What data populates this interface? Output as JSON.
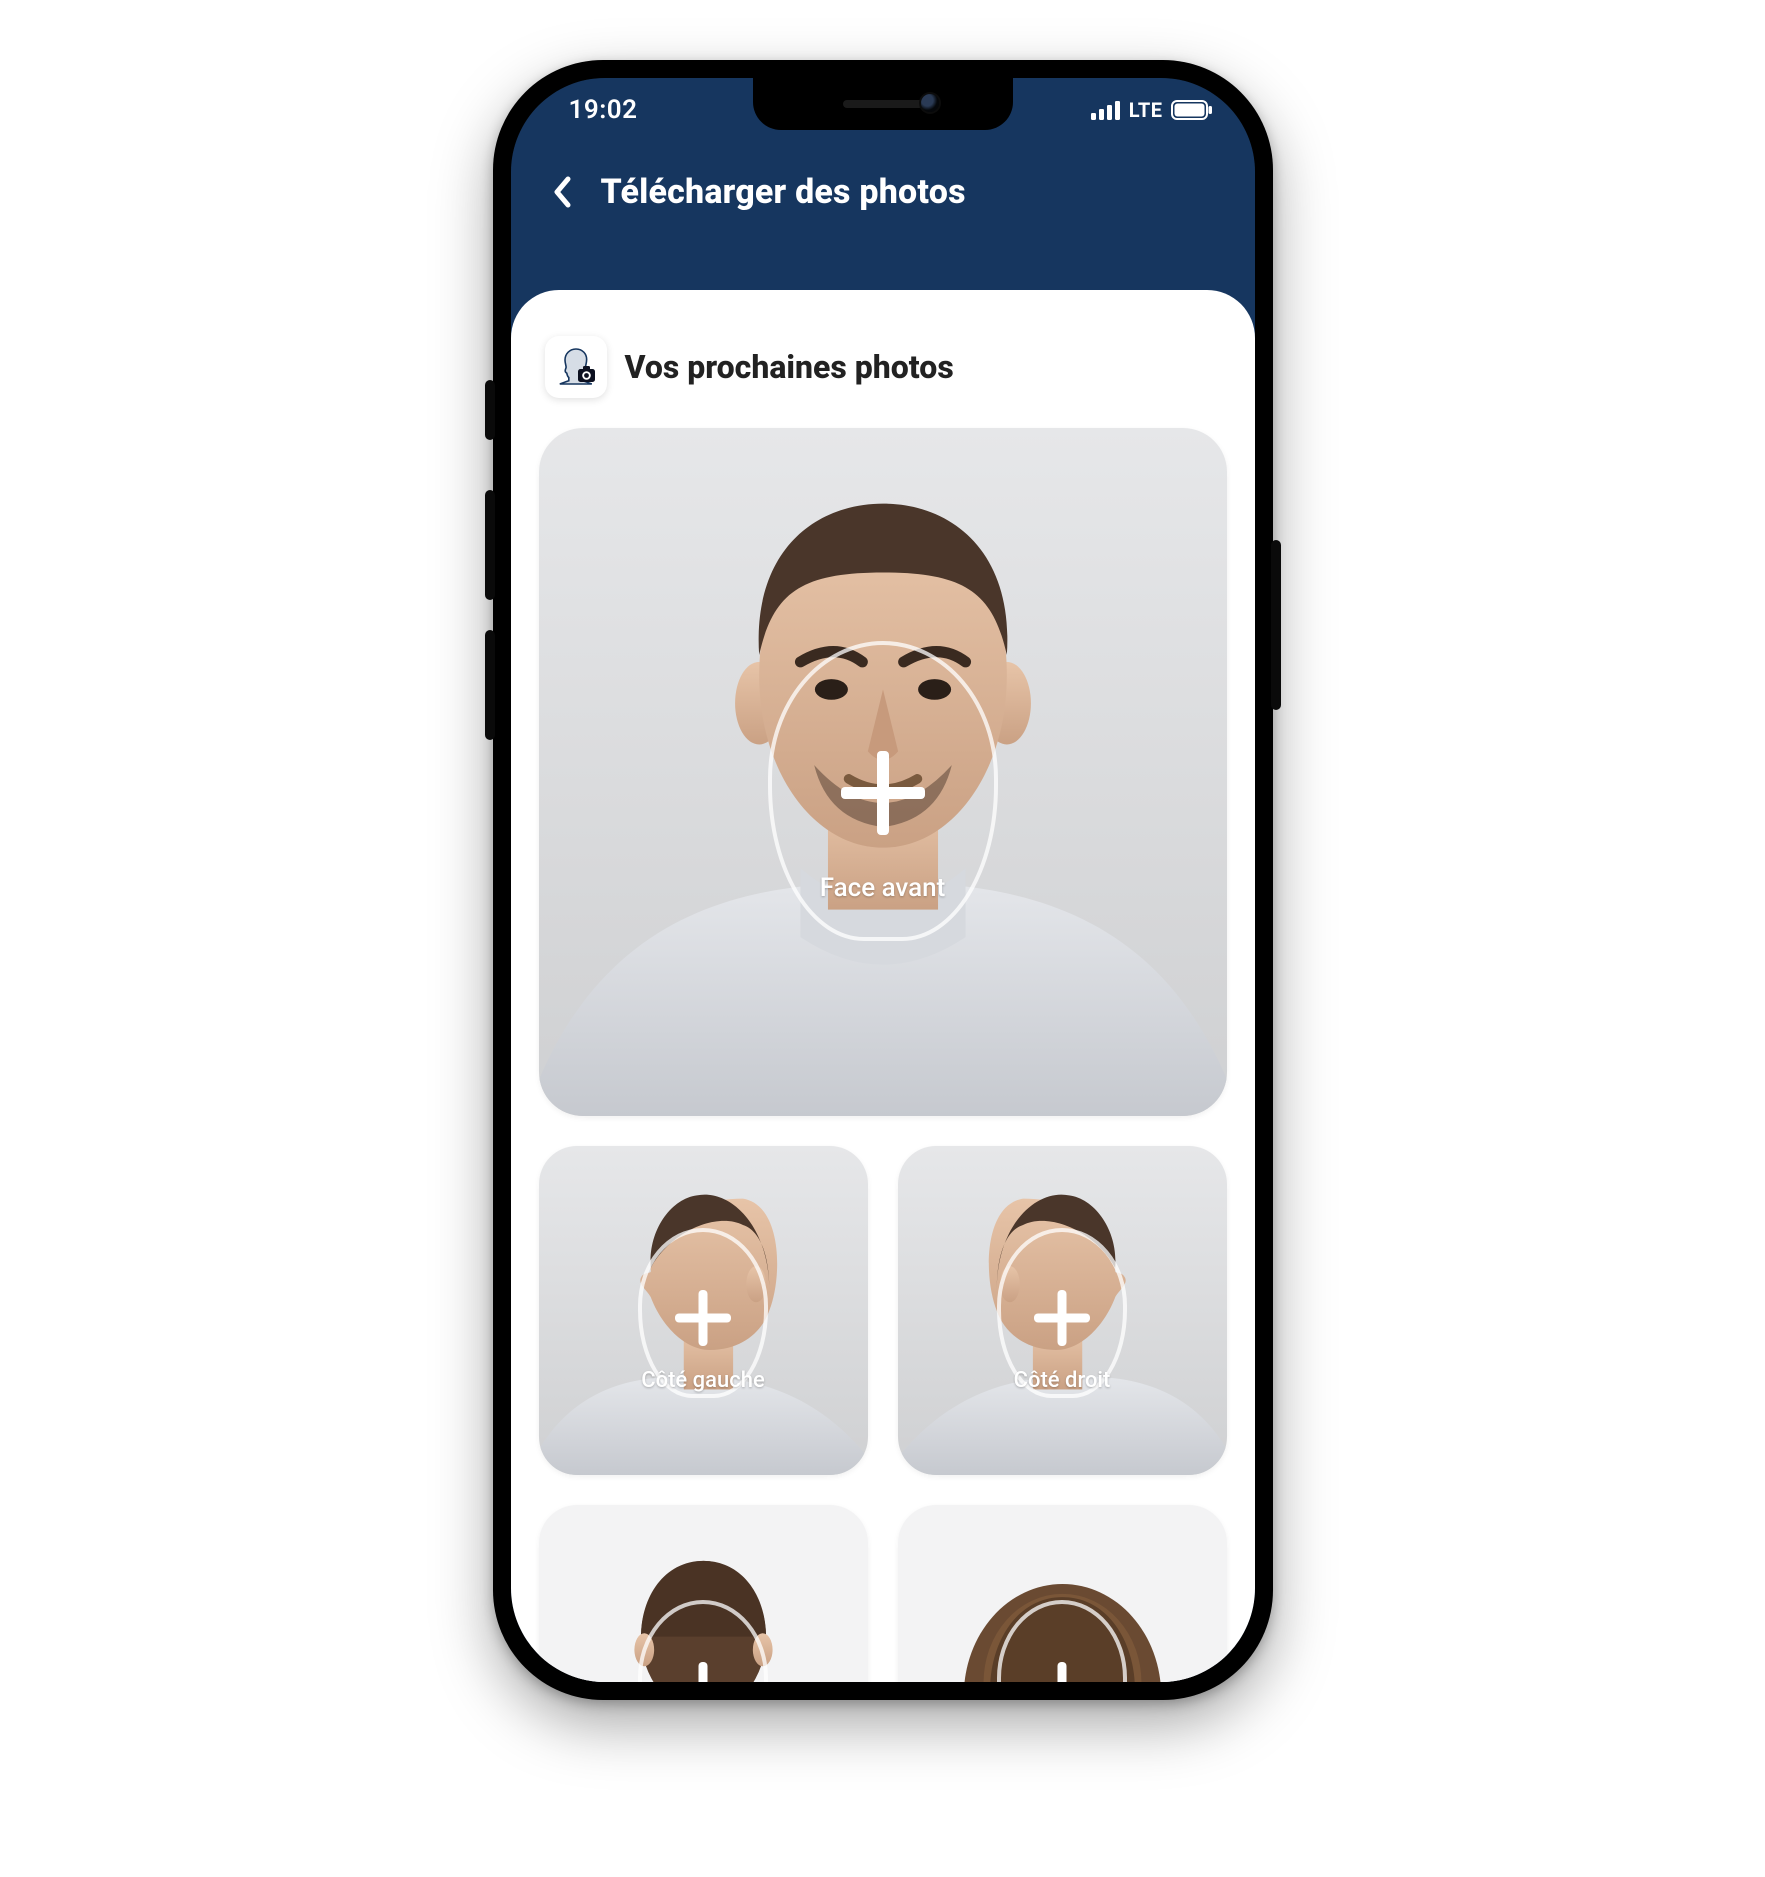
{
  "status": {
    "time": "19:02",
    "network": "LTE"
  },
  "header": {
    "title": "Télécharger des photos"
  },
  "section": {
    "title": "Vos prochaines photos"
  },
  "tiles": {
    "front": {
      "label": "Face avant"
    },
    "left": {
      "label": "Côté gauche"
    },
    "right": {
      "label": "Côté droit"
    },
    "back": {
      "label": ""
    },
    "top": {
      "label": ""
    }
  },
  "colors": {
    "header_bg": "#16365f",
    "sheet_bg": "#ffffff",
    "tile_bg": "#d6d7d9"
  }
}
